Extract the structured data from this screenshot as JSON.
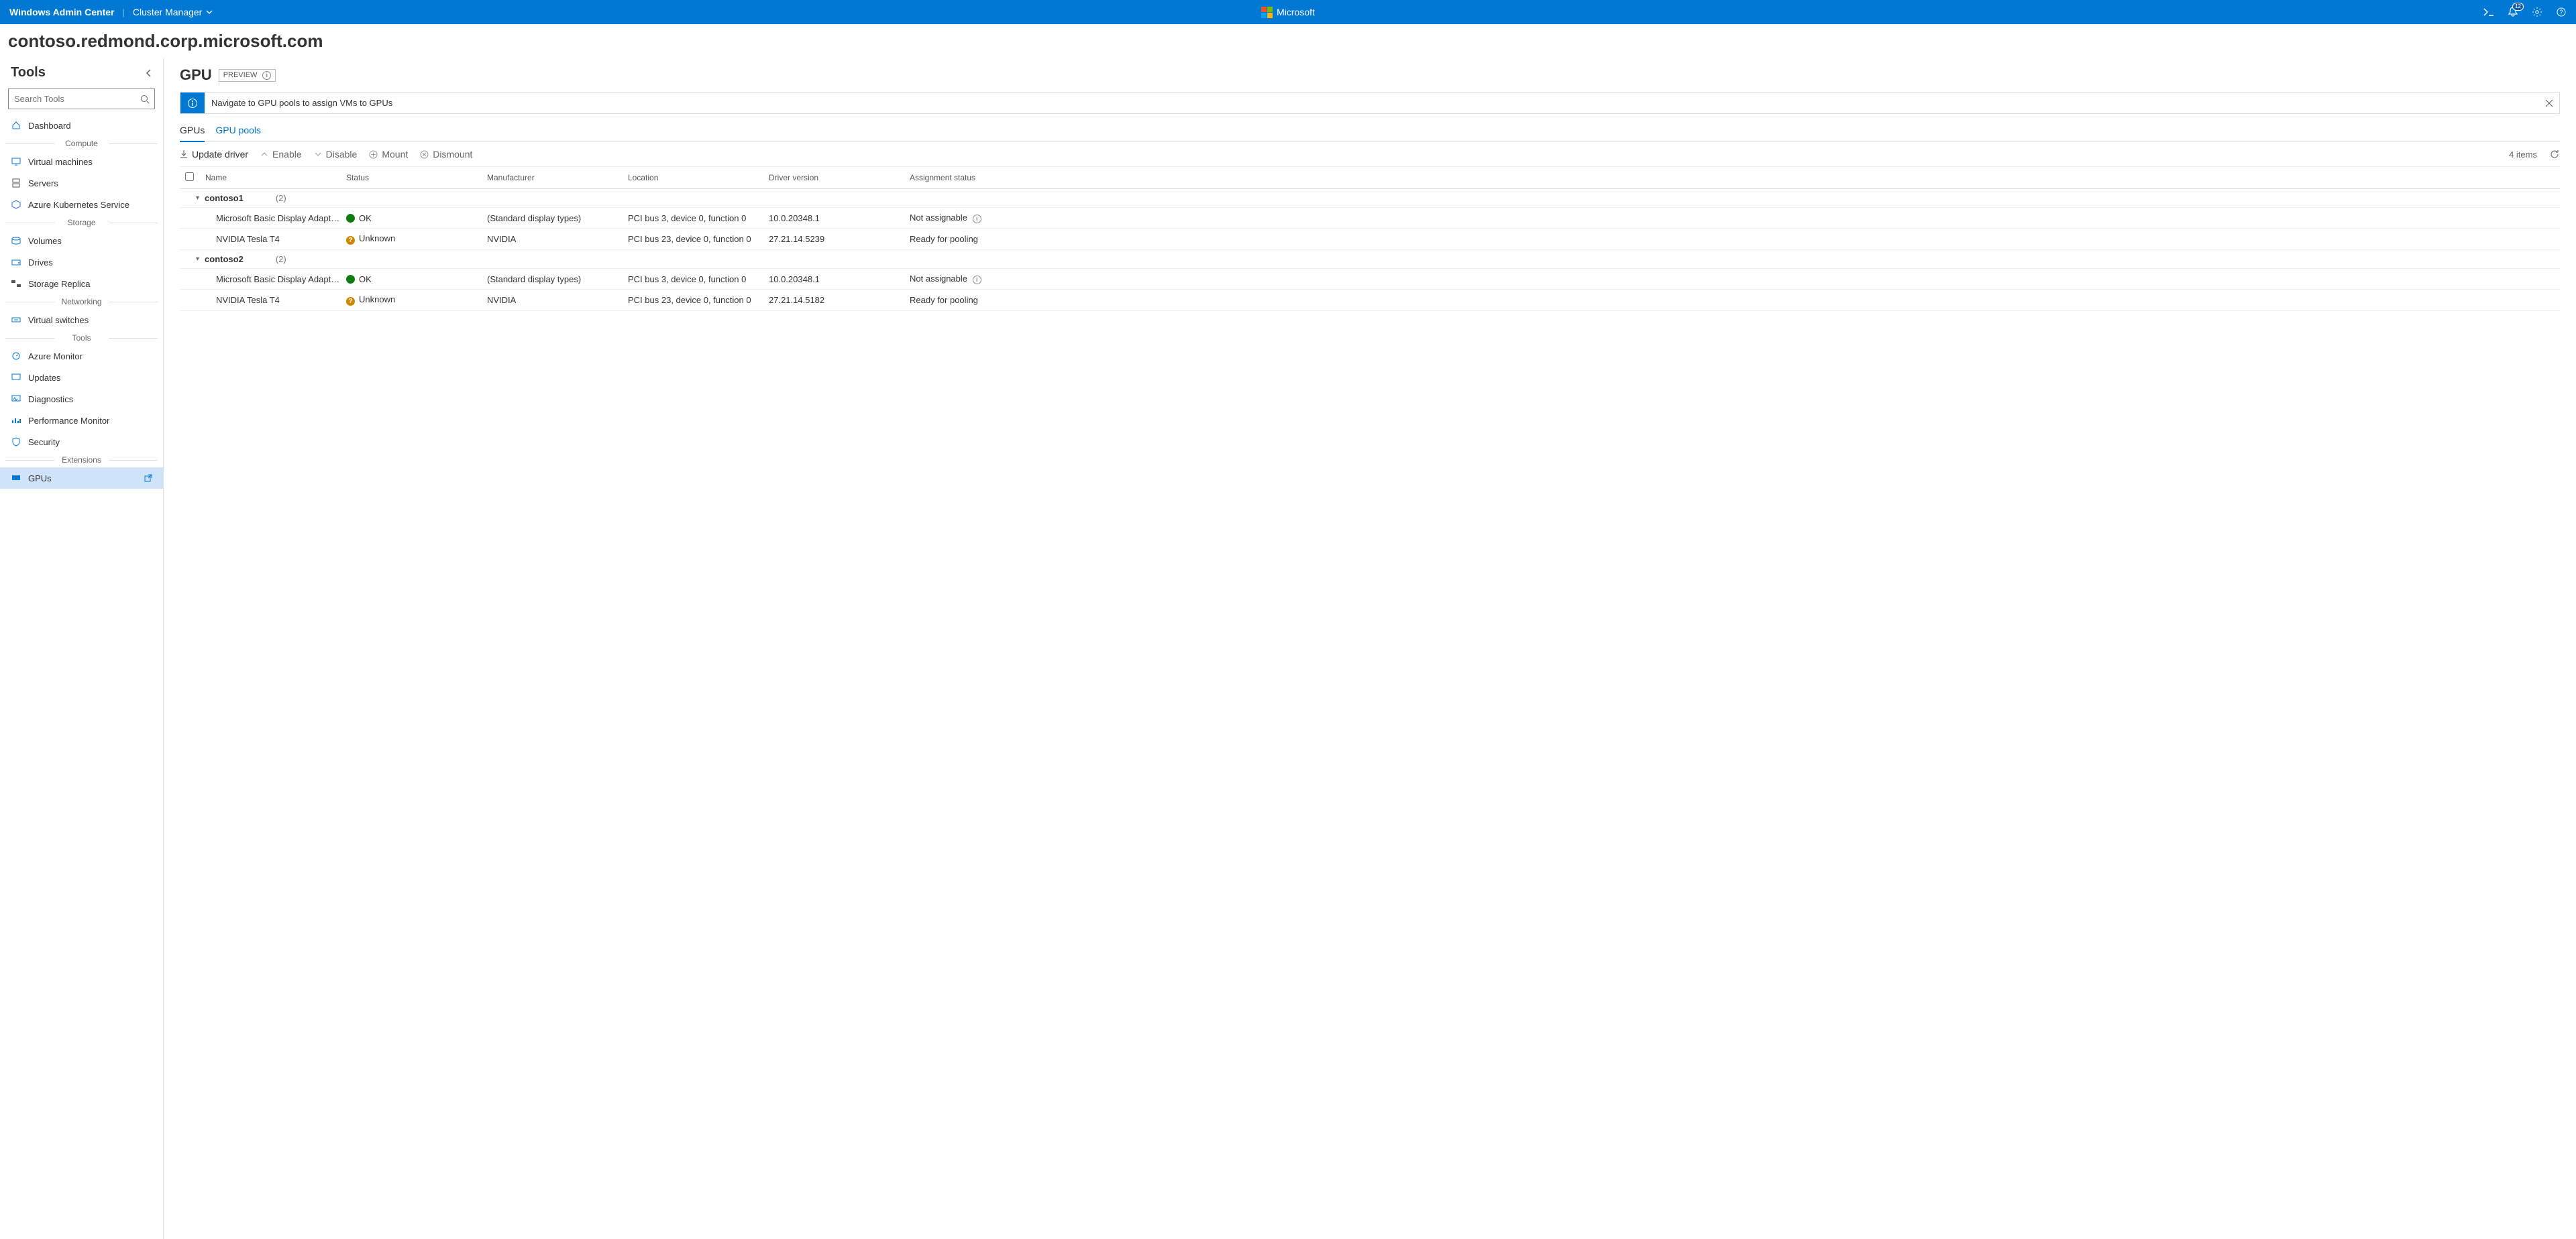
{
  "topbar": {
    "app_title": "Windows Admin Center",
    "context": "Cluster Manager",
    "brand": "Microsoft",
    "notification_count": "12"
  },
  "cluster": {
    "name": "contoso.redmond.corp.microsoft.com"
  },
  "sidebar": {
    "title": "Tools",
    "search_placeholder": "Search Tools",
    "groups": {
      "compute": "Compute",
      "storage": "Storage",
      "networking": "Networking",
      "tools": "Tools",
      "extensions": "Extensions"
    },
    "items": {
      "dashboard": "Dashboard",
      "vms": "Virtual machines",
      "servers": "Servers",
      "aks": "Azure Kubernetes Service",
      "volumes": "Volumes",
      "drives": "Drives",
      "storage_replica": "Storage Replica",
      "vswitches": "Virtual switches",
      "azure_monitor": "Azure Monitor",
      "updates": "Updates",
      "diagnostics": "Diagnostics",
      "perf": "Performance Monitor",
      "security": "Security",
      "gpus": "GPUs"
    }
  },
  "page": {
    "heading": "GPU",
    "preview_label": "PREVIEW",
    "banner_text": "Navigate to GPU pools to assign VMs to GPUs",
    "tabs": {
      "gpus": "GPUs",
      "pools": "GPU pools"
    },
    "commands": {
      "update": "Update driver",
      "enable": "Enable",
      "disable": "Disable",
      "mount": "Mount",
      "dismount": "Dismount"
    },
    "items_count": "4 items"
  },
  "table": {
    "columns": {
      "name": "Name",
      "status": "Status",
      "manufacturer": "Manufacturer",
      "location": "Location",
      "driver": "Driver version",
      "assignment": "Assignment status"
    },
    "groups": [
      {
        "name": "contoso1",
        "count": "(2)",
        "rows": [
          {
            "name": "Microsoft Basic Display Adapter (Low Resolu…",
            "status": "OK",
            "status_kind": "ok",
            "manufacturer": "(Standard display types)",
            "location": "PCI bus 3, device 0, function 0",
            "driver": "10.0.20348.1",
            "assignment": "Not assignable",
            "assign_info": true
          },
          {
            "name": "NVIDIA Tesla T4",
            "status": "Unknown",
            "status_kind": "unk",
            "manufacturer": "NVIDIA",
            "location": "PCI bus 23, device 0, function 0",
            "driver": "27.21.14.5239",
            "assignment": "Ready for pooling",
            "assign_info": false
          }
        ]
      },
      {
        "name": "contoso2",
        "count": "(2)",
        "rows": [
          {
            "name": "Microsoft Basic Display Adapter (Low Resolu…",
            "status": "OK",
            "status_kind": "ok",
            "manufacturer": "(Standard display types)",
            "location": "PCI bus 3, device 0, function 0",
            "driver": "10.0.20348.1",
            "assignment": "Not assignable",
            "assign_info": true
          },
          {
            "name": "NVIDIA Tesla T4",
            "status": "Unknown",
            "status_kind": "unk",
            "manufacturer": "NVIDIA",
            "location": "PCI bus 23, device 0, function 0",
            "driver": "27.21.14.5182",
            "assignment": "Ready for pooling",
            "assign_info": false
          }
        ]
      }
    ]
  }
}
